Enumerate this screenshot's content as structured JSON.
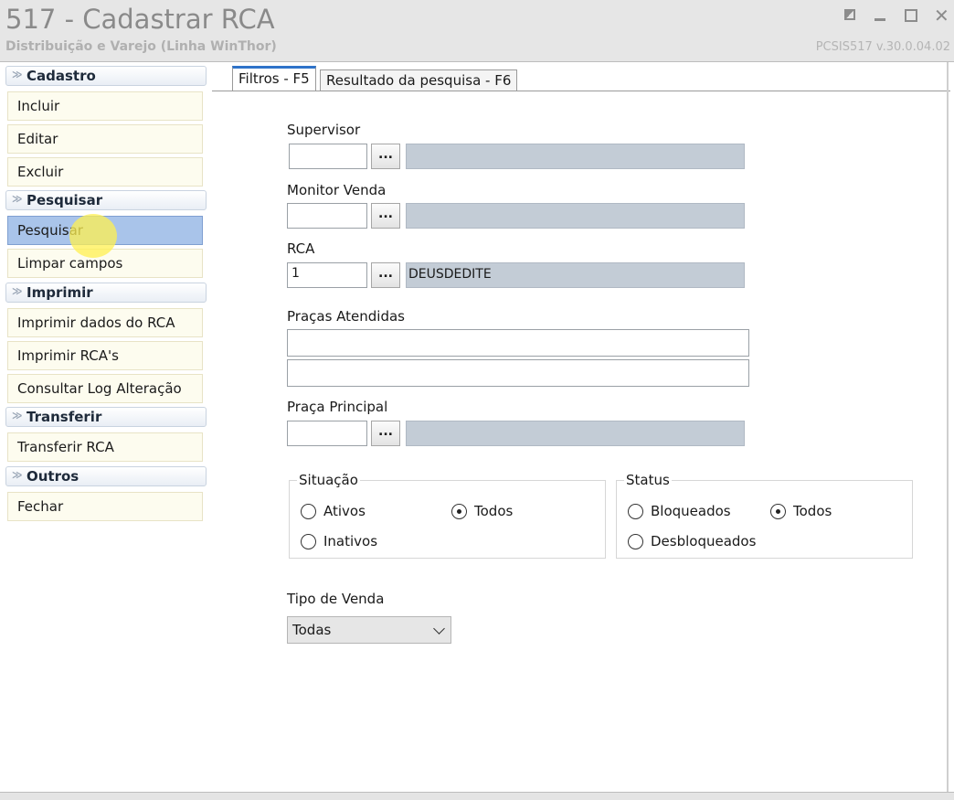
{
  "window": {
    "title": "517 - Cadastrar RCA",
    "subtitle": "Distribuição e Varejo (Linha WinThor)",
    "version": "PCSIS517  v.30.0.04.02",
    "close_glyph": "✕"
  },
  "sidebar": {
    "groups": [
      {
        "label": "Cadastro",
        "items": [
          "Incluir",
          "Editar",
          "Excluir"
        ]
      },
      {
        "label": "Pesquisar",
        "items": [
          "Pesquisar",
          "Limpar campos"
        ]
      },
      {
        "label": "Imprimir",
        "items": [
          "Imprimir dados do RCA",
          "Imprimir RCA's",
          "Consultar Log Alteração"
        ]
      },
      {
        "label": "Transferir",
        "items": [
          "Transferir RCA"
        ]
      },
      {
        "label": "Outros",
        "items": [
          "Fechar"
        ]
      }
    ],
    "active_item": "Pesquisar",
    "chevron": "≫"
  },
  "tabs": [
    {
      "label": "Filtros - F5",
      "active": true
    },
    {
      "label": "Resultado da pesquisa - F6",
      "active": false
    }
  ],
  "form": {
    "supervisor": {
      "label": "Supervisor",
      "code": "",
      "description": ""
    },
    "monitor_venda": {
      "label": "Monitor Venda",
      "code": "",
      "description": ""
    },
    "rca": {
      "label": "RCA",
      "code": "1",
      "description": "DEUSDEDITE"
    },
    "pracas_atendidas": {
      "label": "Praças Atendidas",
      "line1": "",
      "line2": ""
    },
    "praca_principal": {
      "label": "Praça Principal",
      "code": "",
      "description": ""
    },
    "lookup_button": "...",
    "situacao": {
      "legend": "Situação",
      "options": [
        "Ativos",
        "Todos",
        "Inativos"
      ],
      "selected": "Todos"
    },
    "status": {
      "legend": "Status",
      "options": [
        "Bloqueados",
        "Todos",
        "Desbloqueados"
      ],
      "selected": "Todos"
    },
    "tipo_venda": {
      "label": "Tipo de Venda",
      "value": "Todas"
    }
  },
  "colors": {
    "accent": "#2e73c9",
    "active_item": "#a9c4ea",
    "description_field": "#c3ccd6"
  }
}
